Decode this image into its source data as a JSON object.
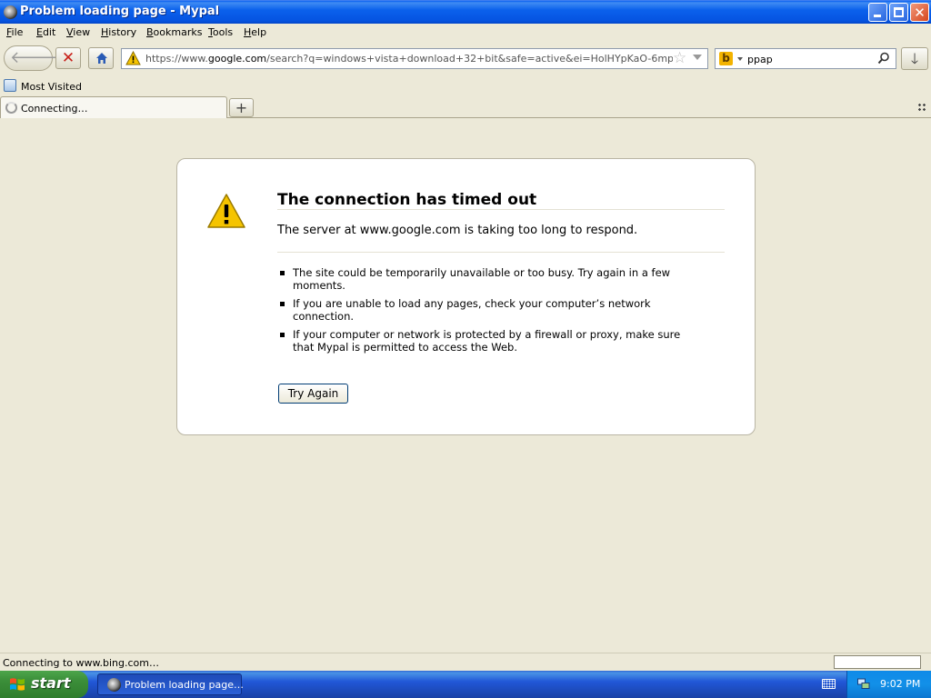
{
  "window": {
    "title": "Problem loading page - Mypal",
    "icon": "mypal-icon",
    "controls": {
      "minimize": "minimize",
      "maximize": "maximize",
      "close": "✕"
    }
  },
  "menu": {
    "items": [
      {
        "accel": "F",
        "rest": "ile"
      },
      {
        "accel": "E",
        "rest": "dit"
      },
      {
        "accel": "V",
        "rest": "iew"
      },
      {
        "accel": "H",
        "rest": "istory"
      },
      {
        "accel": "B",
        "rest": "ookmarks"
      },
      {
        "accel": "T",
        "rest": "ools"
      },
      {
        "accel": "H",
        "rest": "elp"
      }
    ]
  },
  "toolbar": {
    "back_icon": "🡐",
    "forward_icon": "🡒",
    "stop_icon": "✕",
    "url_host_prefix": "https://www.",
    "url_host": "google.com",
    "url_rest": "/search?q=windows+vista+download+32+bit&safe=active&ei=HolHYpKaO-6mptQPr9GIuAE&s",
    "bookmark_star": "☆",
    "search_engine": "b",
    "search_value": "ppap",
    "download_icon": "🡓"
  },
  "bookmarks": {
    "items": [
      {
        "label": "Most Visited",
        "icon": "most-visited-icon"
      }
    ]
  },
  "tabs": {
    "items": [
      {
        "label": "Connecting…",
        "active": true
      }
    ],
    "new_tab_label": "+"
  },
  "error": {
    "title": "The connection has timed out",
    "description": "The server at www.google.com is taking too long to respond.",
    "bullets": [
      "The site could be temporarily unavailable or too busy. Try again in a few moments.",
      "If you are unable to load any pages, check your computer’s network connection.",
      "If your computer or network is protected by a firewall or proxy, make sure that Mypal is permitted to access the Web."
    ],
    "button_label": "Try Again"
  },
  "status": {
    "text": "Connecting to www.bing.com…"
  },
  "taskbar": {
    "start_label": "start",
    "items": [
      {
        "label": "Problem loading page…"
      }
    ],
    "clock": "9:02 PM"
  },
  "colors": {
    "titlebar": "#0553e1",
    "chrome": "#ece9d8",
    "taskbar": "#2157d7",
    "start": "#3c8f3a",
    "stop_red": "#c8201a",
    "warning_yellow": "#f5c400"
  }
}
